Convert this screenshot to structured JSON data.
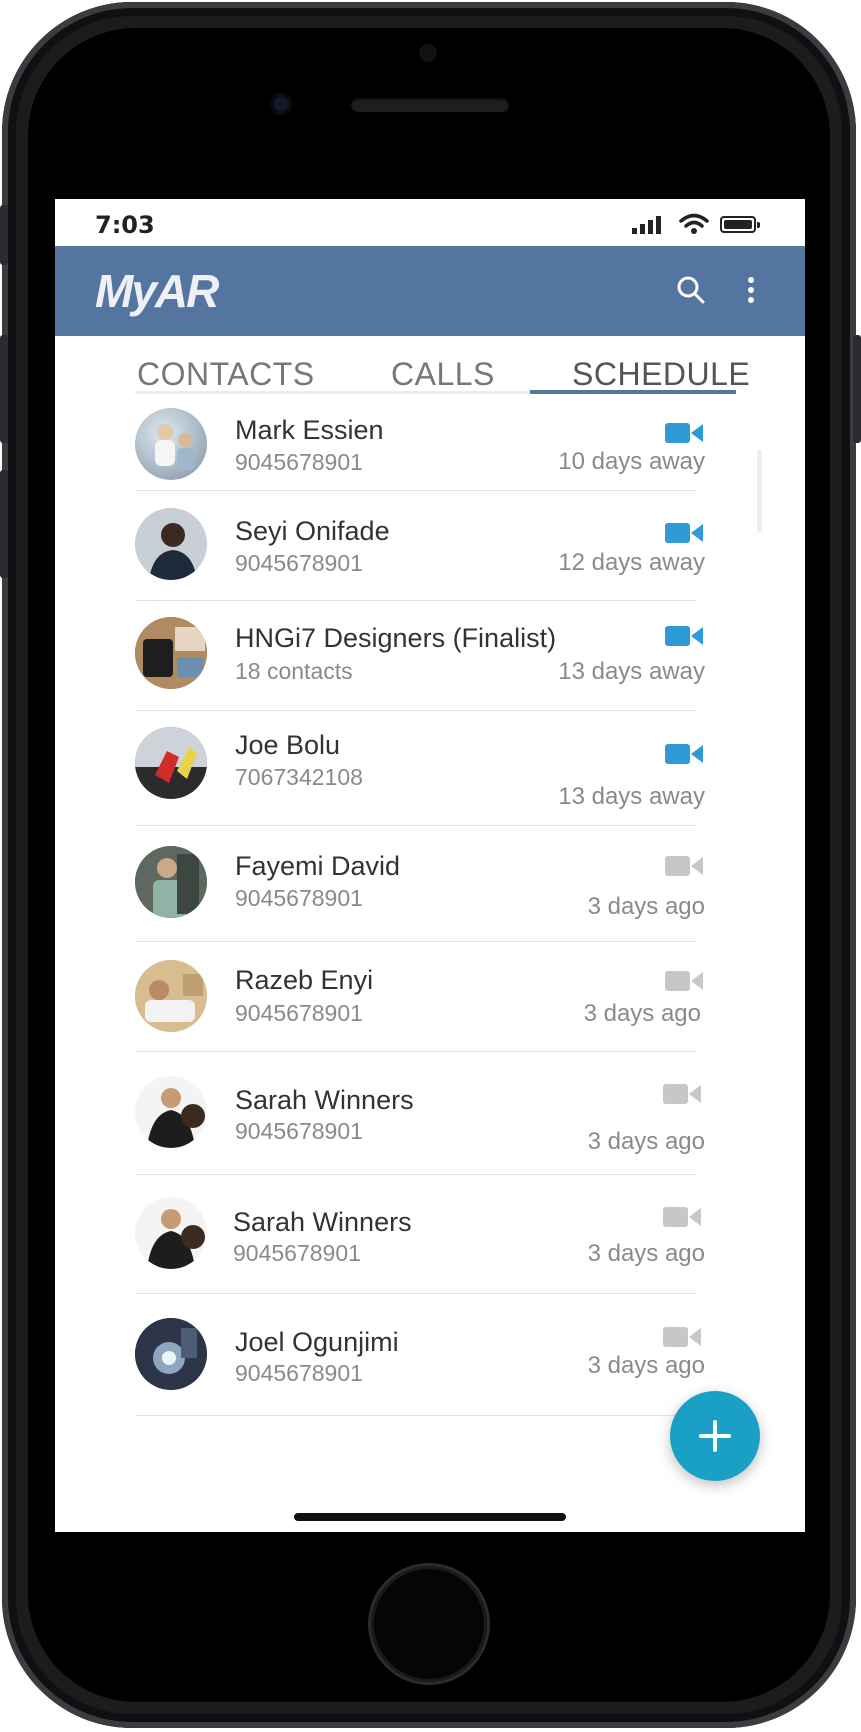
{
  "status_bar": {
    "time": "7:03"
  },
  "app_bar": {
    "logo_text": "MyAR",
    "search_icon": "search-icon",
    "menu_icon": "more-vert-icon"
  },
  "tabs": [
    {
      "label": "CONTACTS",
      "active": false
    },
    {
      "label": "CALLS",
      "active": false
    },
    {
      "label": "SCHEDULE",
      "active": true
    }
  ],
  "colors": {
    "app_bar": "#5475a0",
    "video_active": "#2e9ad6",
    "video_inactive": "#c7c7c7",
    "fab": "#1aa0c4"
  },
  "schedule": [
    {
      "name": "Mark Essien",
      "detail": "9045678901",
      "when": "10 days away",
      "video_icon": "video-camera-icon",
      "upcoming": true
    },
    {
      "name": "Seyi Onifade",
      "detail": "9045678901",
      "when": "12 days away",
      "video_icon": "video-camera-icon",
      "upcoming": true
    },
    {
      "name": "HNGi7 Designers (Finalist)",
      "detail": "18 contacts",
      "when": "13 days away",
      "video_icon": "video-camera-icon",
      "upcoming": true
    },
    {
      "name": "Joe Bolu",
      "detail": "7067342108",
      "when": "13 days away",
      "video_icon": "video-camera-icon",
      "upcoming": true
    },
    {
      "name": "Fayemi David",
      "detail": "9045678901",
      "when": "3 days ago",
      "video_icon": "video-camera-icon",
      "upcoming": false
    },
    {
      "name": "Razeb Enyi",
      "detail": "9045678901",
      "when": "3 days ago",
      "video_icon": "video-camera-icon",
      "upcoming": false
    },
    {
      "name": "Sarah Winners",
      "detail": "9045678901",
      "when": "3 days ago",
      "video_icon": "video-camera-icon",
      "upcoming": false
    },
    {
      "name": "Sarah Winners",
      "detail": "9045678901",
      "when": "3 days ago",
      "video_icon": "video-camera-icon",
      "upcoming": false
    },
    {
      "name": "Joel Ogunjimi",
      "detail": "9045678901",
      "when": "3 days ago",
      "video_icon": "video-camera-icon",
      "upcoming": false
    }
  ],
  "fab": {
    "icon": "plus-icon"
  }
}
